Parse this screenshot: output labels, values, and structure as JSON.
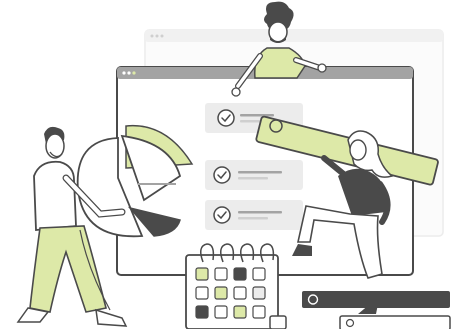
{
  "palette": {
    "accent": "#dde9a8",
    "ink": "#4a4a4a",
    "gray": "#a3a3a3",
    "light_gray": "#ececec",
    "panel": "#f6f6f6"
  },
  "illustration": {
    "icons": [
      "browser-window-icon",
      "checkmark-icon",
      "pie-chart-icon",
      "calendar-icon",
      "search-bar-icon"
    ],
    "checklist_items_checked": 3,
    "calendar_rings": 4
  }
}
